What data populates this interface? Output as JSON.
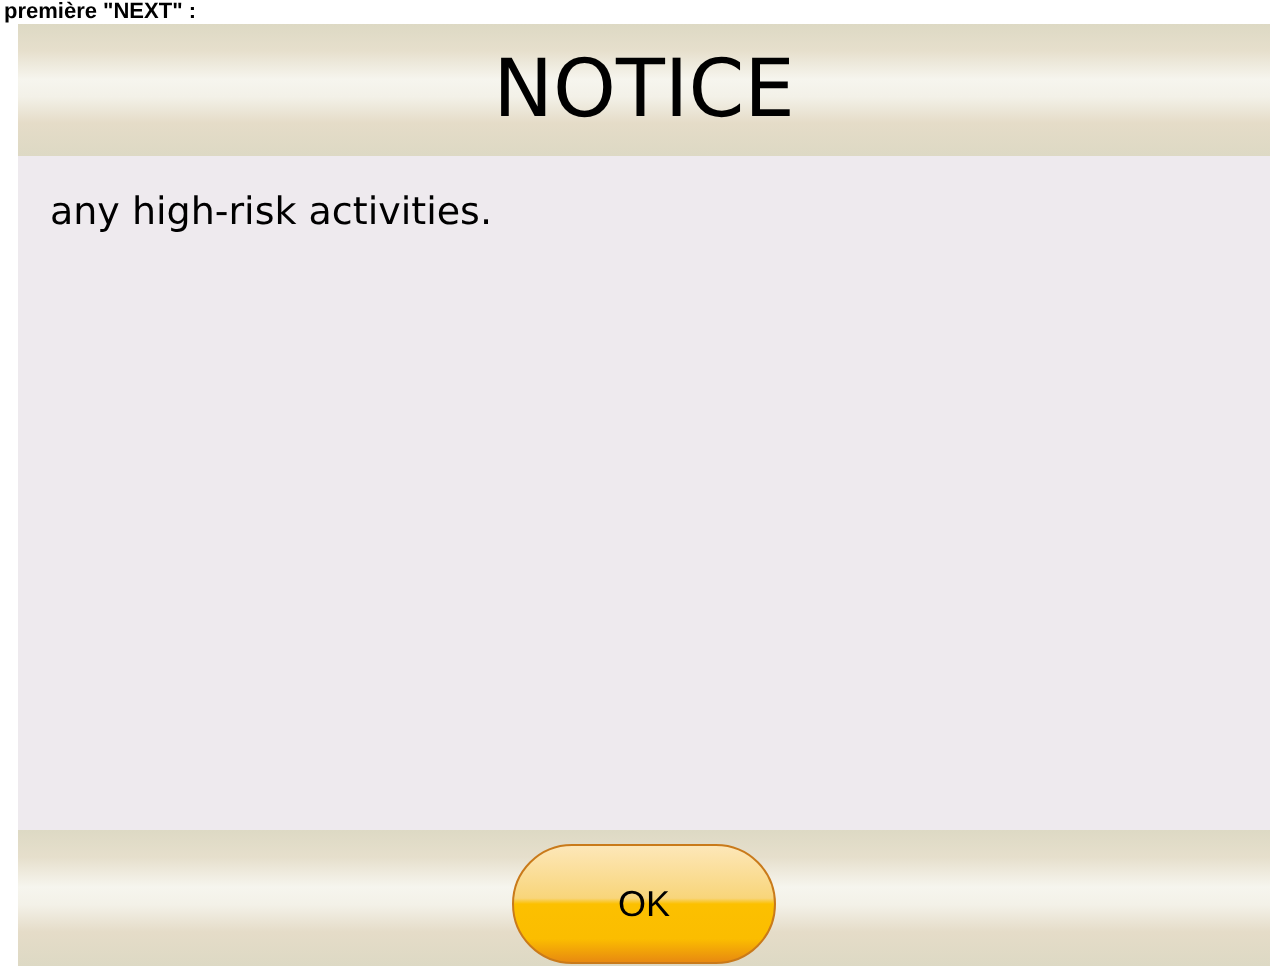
{
  "top_text": "première \"NEXT\" :",
  "dialog": {
    "title": "NOTICE",
    "message": "any high-risk activities.",
    "buttons": [
      "OK"
    ]
  }
}
